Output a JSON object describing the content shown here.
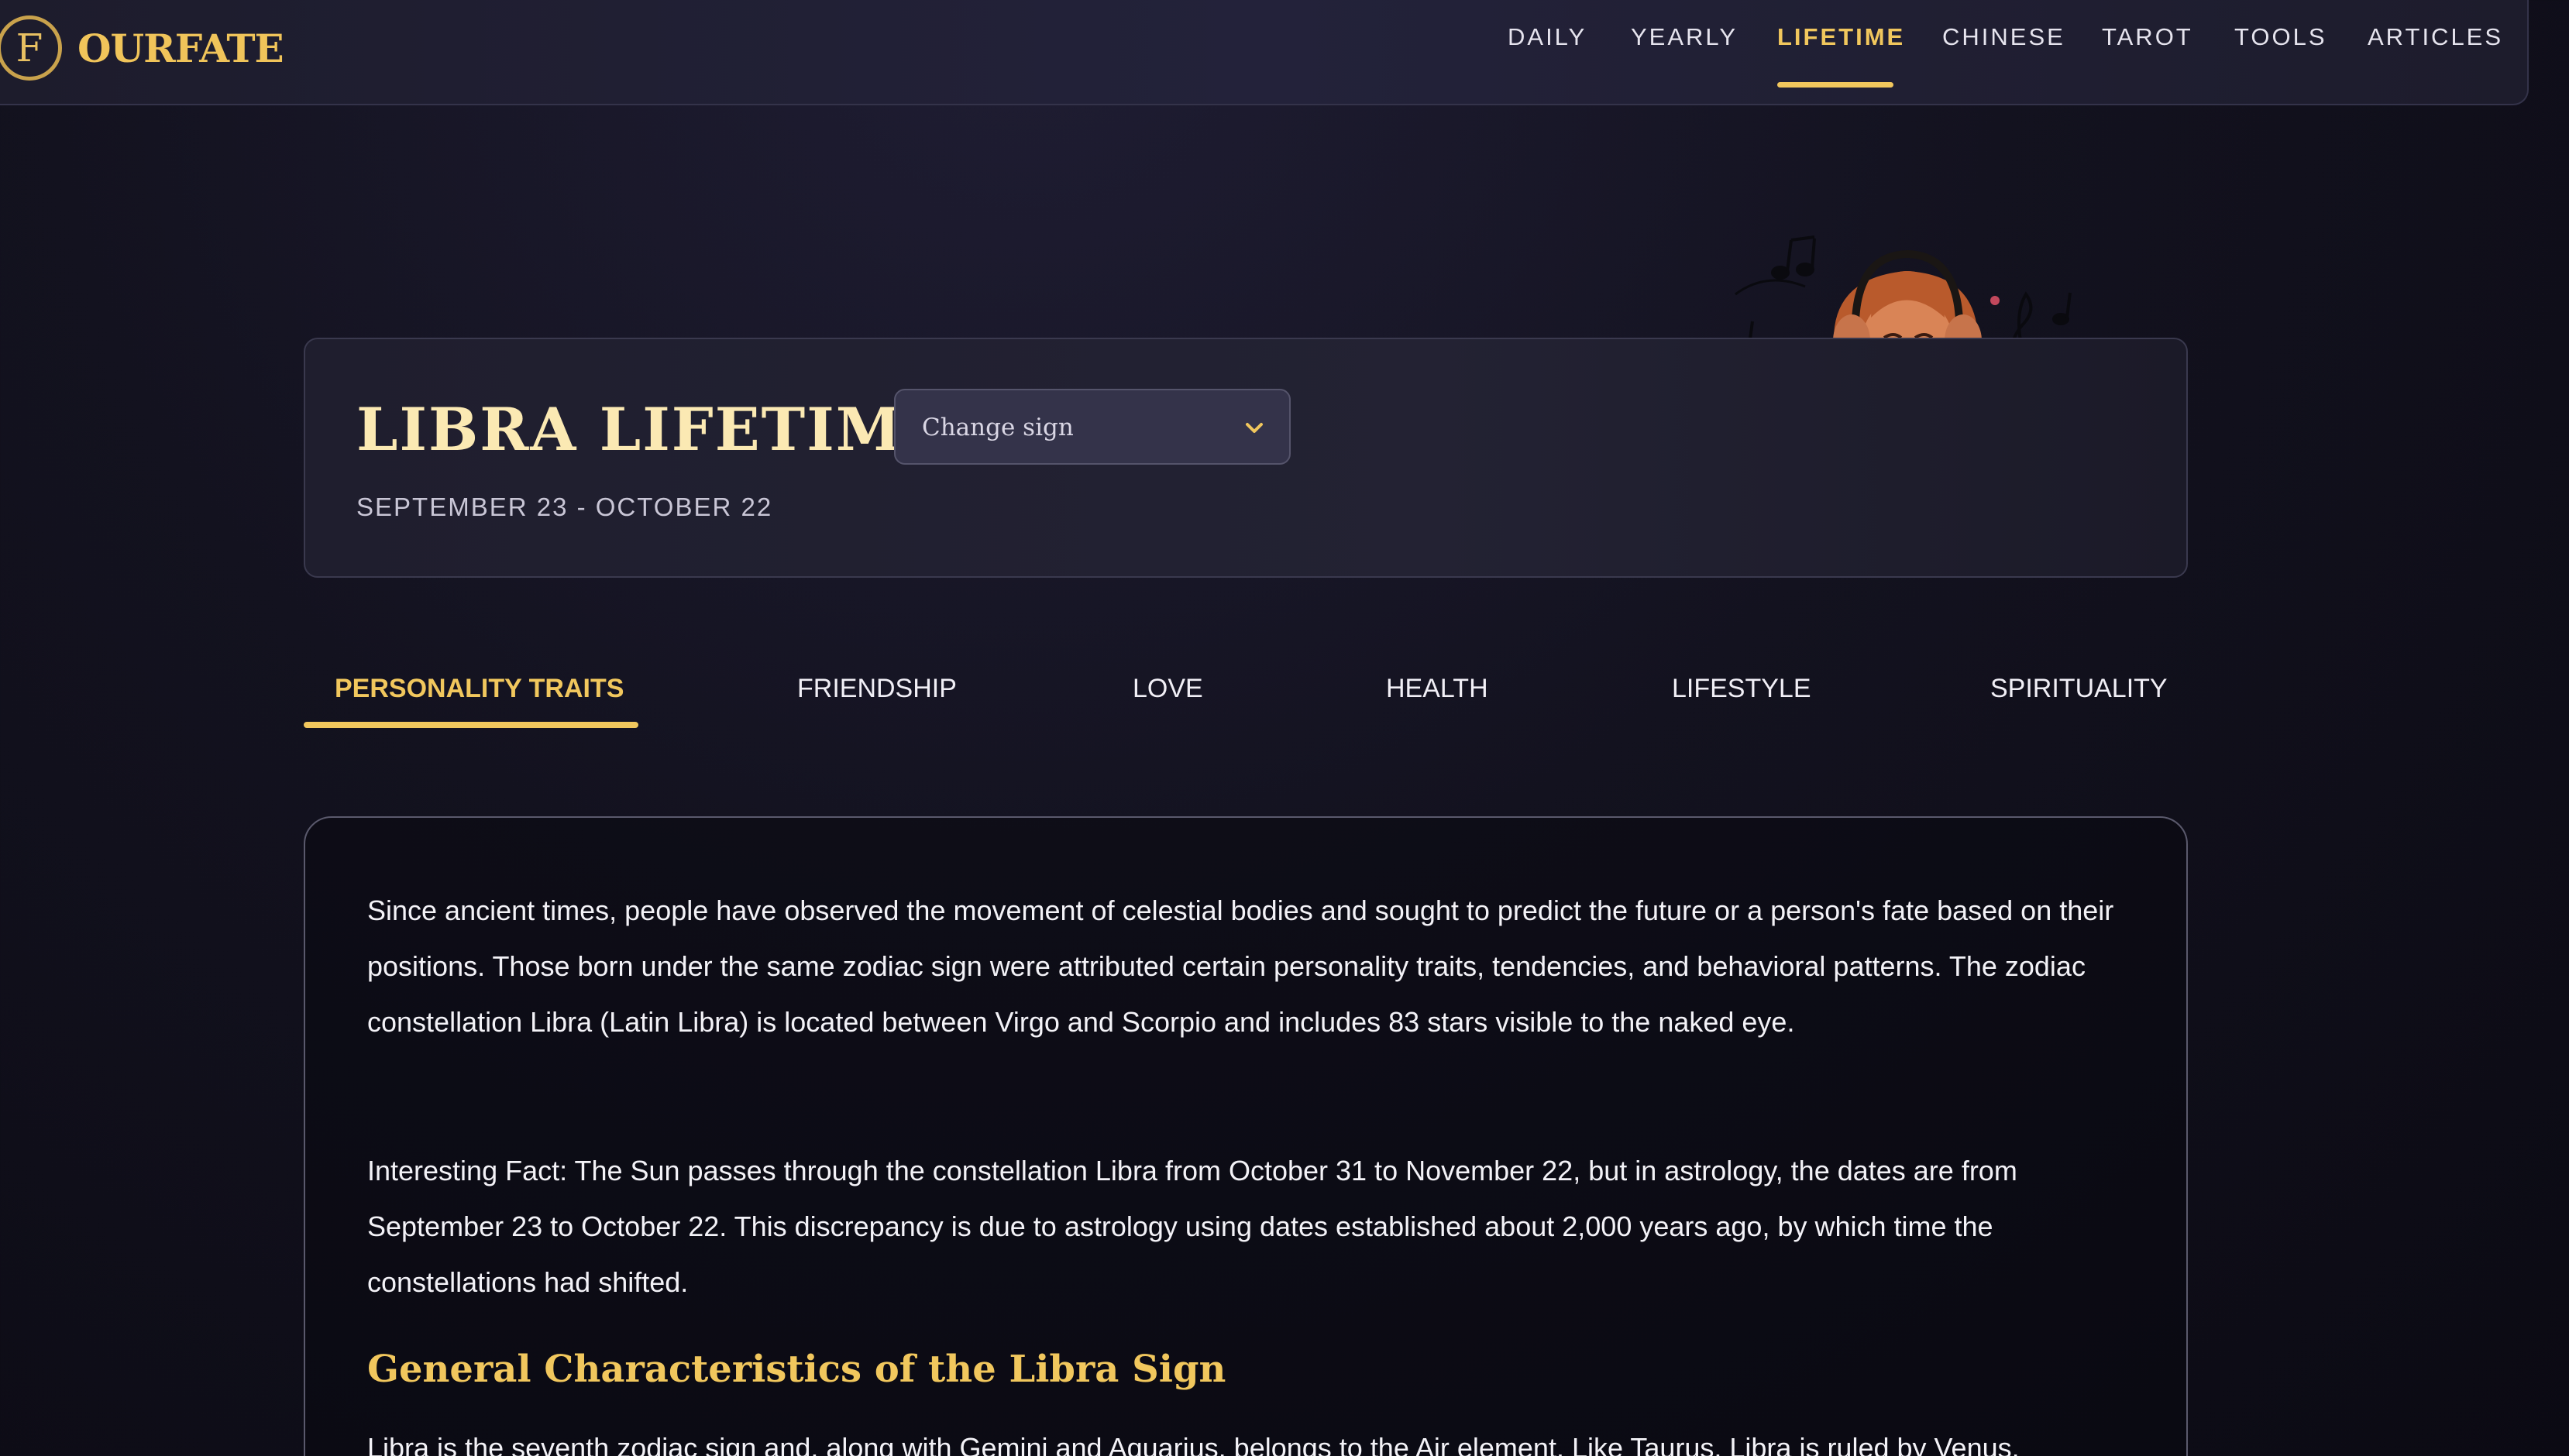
{
  "brand": {
    "logo_letter": "F",
    "name": "OURFATE"
  },
  "nav": {
    "items": [
      {
        "label": "DAILY"
      },
      {
        "label": "YEARLY"
      },
      {
        "label": "LIFETIME",
        "active": true
      },
      {
        "label": "CHINESE"
      },
      {
        "label": "TAROT"
      },
      {
        "label": "TOOLS"
      },
      {
        "label": "ARTICLES"
      }
    ]
  },
  "hero": {
    "title": "LIBRA LIFETIME",
    "dates": "SEPTEMBER 23 - OCTOBER 22",
    "sign_select": {
      "label": "Change sign",
      "icon": "chevron-down-icon"
    }
  },
  "tabs": [
    {
      "label": "PERSONALITY TRAITS",
      "active": true
    },
    {
      "label": "FRIENDSHIP"
    },
    {
      "label": "LOVE"
    },
    {
      "label": "HEALTH"
    },
    {
      "label": "LIFESTYLE"
    },
    {
      "label": "SPIRITUALITY"
    }
  ],
  "content": {
    "paragraphs": [
      "Since ancient times, people have observed the movement of celestial bodies and sought to predict the future or a person's fate based on their positions. Those born under the same zodiac sign were attributed certain personality traits, tendencies, and behavioral patterns. The zodiac constellation Libra (Latin Libra) is located between Virgo and Scorpio and includes 83 stars visible to the naked eye.",
      "Interesting Fact: The Sun passes through the constellation Libra from October 31 to November 22, but in astrology, the dates are from September 23 to October 22. This discrepancy is due to astrology using dates established about 2,000 years ago, by which time the constellations had shifted."
    ],
    "section_heading": "General Characteristics of the Libra Sign",
    "section_text": "Libra is the seventh zodiac sign and, along with Gemini and Aquarius, belongs to the Air element. Like Taurus, Libra is ruled by Venus."
  },
  "colors": {
    "accent_gold": "#f1c75d",
    "title_cream": "#fbe9b3",
    "background": "#0b0a13"
  }
}
